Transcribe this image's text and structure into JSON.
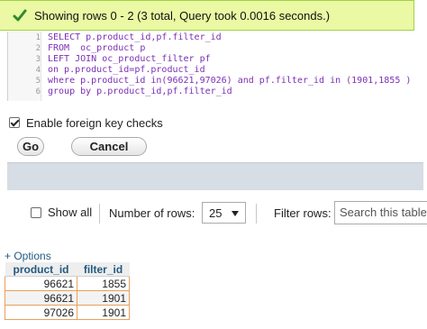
{
  "success": {
    "message": "Showing rows 0 - 2 (3 total, Query took 0.0016 seconds.)",
    "icon": "check-icon",
    "color": "#2e8b2e"
  },
  "sql": {
    "lines": [
      {
        "num": "1",
        "text": "SELECT p.product_id,pf.filter_id"
      },
      {
        "num": "2",
        "text": "FROM  oc_product p"
      },
      {
        "num": "3",
        "text": "LEFT JOIN oc_product_filter pf"
      },
      {
        "num": "4",
        "text": "on p.product_id=pf.product_id"
      },
      {
        "num": "5",
        "text": "where p.product_id in(96621,97026) and pf.filter_id in (1901,1855 )"
      },
      {
        "num": "6",
        "text": "group by p.product_id,pf.filter_id"
      }
    ]
  },
  "options": {
    "foreign_key_label": "Enable foreign key checks",
    "foreign_key_checked": true,
    "go_label": "Go",
    "cancel_label": "Cancel"
  },
  "nav": {
    "show_all_label": "Show all",
    "number_of_rows_label": "Number of rows:",
    "rows_value": "25",
    "filter_rows_label": "Filter rows:",
    "filter_placeholder": "Search this table"
  },
  "results": {
    "options_link": "+ Options",
    "columns": [
      "product_id",
      "filter_id"
    ],
    "rows": [
      [
        "96621",
        "1855"
      ],
      [
        "96621",
        "1901"
      ],
      [
        "97026",
        "1901"
      ]
    ]
  }
}
